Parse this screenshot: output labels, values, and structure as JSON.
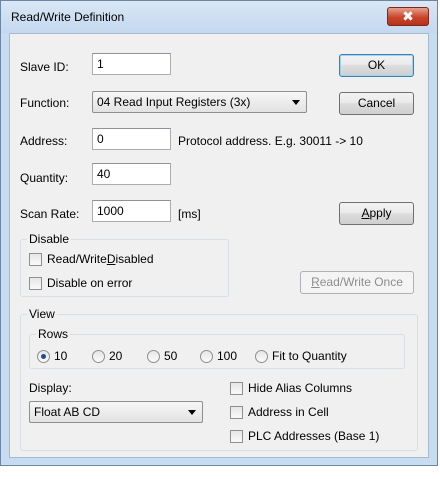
{
  "window": {
    "title": "Read/Write Definition",
    "close_symbol": "✖"
  },
  "form": {
    "slave_id_label": "Slave ID:",
    "slave_id_value": "1",
    "function_label": "Function:",
    "function_value": "04 Read Input Registers (3x)",
    "address_label": "Address:",
    "address_value": "0",
    "address_hint": "Protocol address. E.g. 30011 -> 10",
    "quantity_label": "Quantity:",
    "quantity_value": "40",
    "scan_rate_label": "Scan Rate:",
    "scan_rate_value": "1000",
    "scan_rate_unit": "[ms]"
  },
  "buttons": {
    "ok": "OK",
    "cancel": "Cancel",
    "apply_prefix": "",
    "apply_mnemonic": "A",
    "apply_rest": "pply",
    "rw_once_prefix": "",
    "rw_once_mnemonic": "R",
    "rw_once_rest": "ead/Write Once"
  },
  "disable_group": {
    "title": "Disable",
    "rw_disabled_prefix": "Read/Write ",
    "rw_disabled_mnemonic": "D",
    "rw_disabled_rest": "isabled",
    "rw_disabled_checked": false,
    "disable_on_error": "Disable on error",
    "disable_on_error_checked": false
  },
  "view_group": {
    "title": "View",
    "rows_title": "Rows",
    "rows_options": [
      "10",
      "20",
      "50",
      "100",
      "Fit to Quantity"
    ],
    "rows_selected": "10",
    "display_label": "Display:",
    "display_value": "Float AB CD",
    "hide_alias": "Hide Alias Columns",
    "address_in_cell": "Address in Cell",
    "plc_addresses": "PLC Addresses (Base 1)"
  }
}
